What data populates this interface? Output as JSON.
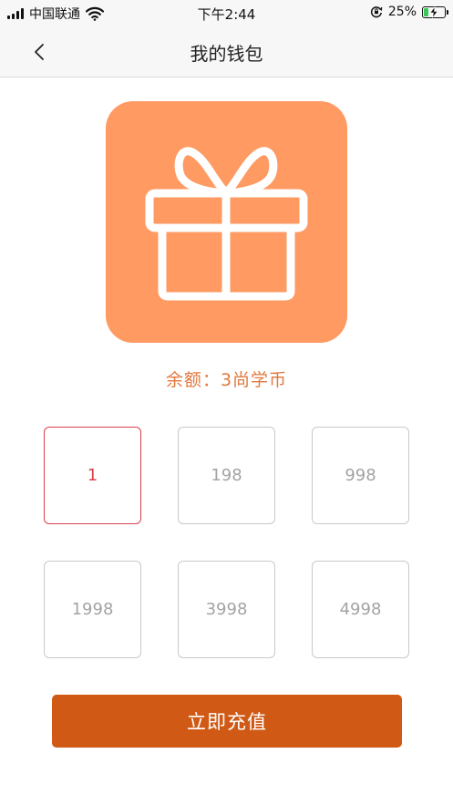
{
  "status_bar": {
    "carrier": "中国联通",
    "time": "下午2:44",
    "battery": "25%",
    "battery_level": 0.25,
    "icons": [
      "signal-icon",
      "wifi-icon",
      "orientation-lock-icon",
      "battery-charging-icon"
    ]
  },
  "nav": {
    "title": "我的钱包",
    "back_icon": "chevron-left-icon"
  },
  "gift": {
    "icon": "gift-icon",
    "color": "#ff9a63"
  },
  "balance": {
    "text": "余额：3尚学币"
  },
  "amounts": [
    {
      "value": "1",
      "selected": true
    },
    {
      "value": "198",
      "selected": false
    },
    {
      "value": "998",
      "selected": false
    },
    {
      "value": "1998",
      "selected": false
    },
    {
      "value": "3998",
      "selected": false
    },
    {
      "value": "4998",
      "selected": false
    }
  ],
  "recharge": {
    "label": "立即充值"
  },
  "colors": {
    "accent": "#d05a15",
    "balance_text": "#e1783e",
    "selected_border": "#d9404a",
    "unselected_text": "#a3a3a3"
  }
}
